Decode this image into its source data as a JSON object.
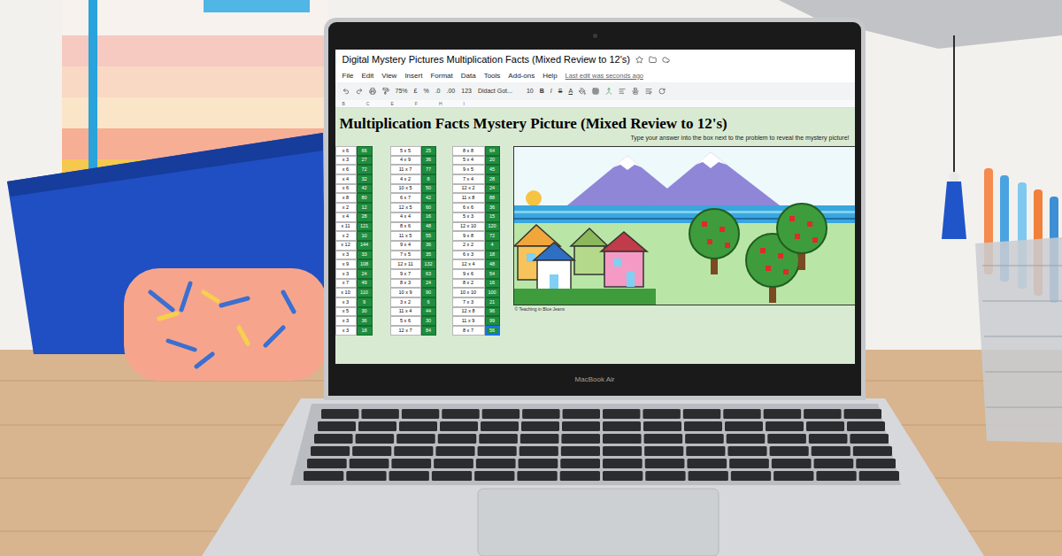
{
  "window": {
    "title": "Digital Mystery Pictures Multiplication Facts (Mixed Review to 12's)",
    "status": "Last edit was seconds ago"
  },
  "menu": [
    "File",
    "Edit",
    "View",
    "Insert",
    "Format",
    "Data",
    "Tools",
    "Add-ons",
    "Help"
  ],
  "toolbar": [
    "75%",
    "£",
    "%",
    ".0",
    ".00",
    "123",
    "Didact Got...",
    "10",
    "B",
    "I",
    "S",
    "A"
  ],
  "column_headers": [
    "B",
    "C",
    "E",
    "F",
    "H",
    "I"
  ],
  "sheet": {
    "heading": "Multiplication Facts Mystery Picture (Mixed Review to 12's)",
    "instruction": "Type your answer into the box next to the problem to reveal the mystery picture!",
    "columns": [
      {
        "cells": [
          {
            "problem": "x 6",
            "answer": "66",
            "selected": false
          },
          {
            "problem": "x 3",
            "answer": "27",
            "selected": false
          },
          {
            "problem": "x 6",
            "answer": "72",
            "selected": false
          },
          {
            "problem": "x 4",
            "answer": "32",
            "selected": false
          },
          {
            "problem": "x 6",
            "answer": "42",
            "selected": false
          },
          {
            "problem": "x 8",
            "answer": "80",
            "selected": false
          },
          {
            "problem": "x 2",
            "answer": "12",
            "selected": false
          },
          {
            "problem": "x 4",
            "answer": "28",
            "selected": false
          },
          {
            "problem": "x 11",
            "answer": "121",
            "selected": false
          },
          {
            "problem": "x 2",
            "answer": "10",
            "selected": false
          },
          {
            "problem": "x 12",
            "answer": "144",
            "selected": false
          },
          {
            "problem": "x 3",
            "answer": "33",
            "selected": false
          },
          {
            "problem": "x 9",
            "answer": "108",
            "selected": false
          },
          {
            "problem": "x 3",
            "answer": "24",
            "selected": false
          },
          {
            "problem": "x 7",
            "answer": "49",
            "selected": false
          },
          {
            "problem": "x 10",
            "answer": "110",
            "selected": false
          },
          {
            "problem": "x 3",
            "answer": "9",
            "selected": false
          },
          {
            "problem": "x 5",
            "answer": "30",
            "selected": false
          },
          {
            "problem": "x 3",
            "answer": "36",
            "selected": false
          },
          {
            "problem": "x 3",
            "answer": "18",
            "selected": false
          }
        ]
      },
      {
        "cells": [
          {
            "problem": "5 x 5",
            "answer": "25",
            "selected": false
          },
          {
            "problem": "4 x 9",
            "answer": "36",
            "selected": false
          },
          {
            "problem": "11 x 7",
            "answer": "77",
            "selected": false
          },
          {
            "problem": "4 x 2",
            "answer": "8",
            "selected": false
          },
          {
            "problem": "10 x 5",
            "answer": "50",
            "selected": false
          },
          {
            "problem": "6 x 7",
            "answer": "42",
            "selected": false
          },
          {
            "problem": "12 x 5",
            "answer": "60",
            "selected": false
          },
          {
            "problem": "4 x 4",
            "answer": "16",
            "selected": false
          },
          {
            "problem": "8 x 6",
            "answer": "48",
            "selected": false
          },
          {
            "problem": "11 x 5",
            "answer": "55",
            "selected": false
          },
          {
            "problem": "9 x 4",
            "answer": "36",
            "selected": false
          },
          {
            "problem": "7 x 5",
            "answer": "35",
            "selected": false
          },
          {
            "problem": "12 x 11",
            "answer": "132",
            "selected": false
          },
          {
            "problem": "9 x 7",
            "answer": "63",
            "selected": false
          },
          {
            "problem": "8 x 3",
            "answer": "24",
            "selected": false
          },
          {
            "problem": "10 x 9",
            "answer": "90",
            "selected": false
          },
          {
            "problem": "3 x 2",
            "answer": "6",
            "selected": false
          },
          {
            "problem": "11 x 4",
            "answer": "44",
            "selected": false
          },
          {
            "problem": "5 x 6",
            "answer": "30",
            "selected": false
          },
          {
            "problem": "12 x 7",
            "answer": "84",
            "selected": false
          }
        ]
      },
      {
        "cells": [
          {
            "problem": "8 x 8",
            "answer": "64",
            "selected": false
          },
          {
            "problem": "5 x 4",
            "answer": "20",
            "selected": false
          },
          {
            "problem": "9 x 5",
            "answer": "45",
            "selected": false
          },
          {
            "problem": "7 x 4",
            "answer": "28",
            "selected": false
          },
          {
            "problem": "12 x 2",
            "answer": "24",
            "selected": false
          },
          {
            "problem": "11 x 8",
            "answer": "88",
            "selected": false
          },
          {
            "problem": "6 x 6",
            "answer": "36",
            "selected": false
          },
          {
            "problem": "5 x 3",
            "answer": "15",
            "selected": false
          },
          {
            "problem": "12 x 10",
            "answer": "120",
            "selected": false
          },
          {
            "problem": "9 x 8",
            "answer": "72",
            "selected": false
          },
          {
            "problem": "2 x 2",
            "answer": "4",
            "selected": false
          },
          {
            "problem": "6 x 3",
            "answer": "18",
            "selected": false
          },
          {
            "problem": "12 x 4",
            "answer": "48",
            "selected": false
          },
          {
            "problem": "9 x 6",
            "answer": "54",
            "selected": false
          },
          {
            "problem": "8 x 2",
            "answer": "16",
            "selected": false
          },
          {
            "problem": "10 x 10",
            "answer": "100",
            "selected": false
          },
          {
            "problem": "7 x 3",
            "answer": "21",
            "selected": false
          },
          {
            "problem": "12 x 8",
            "answer": "96",
            "selected": false
          },
          {
            "problem": "11 x 9",
            "answer": "99",
            "selected": false
          },
          {
            "problem": "8 x 7",
            "answer": "56",
            "selected": true
          }
        ]
      }
    ],
    "credit": "© Teaching in Blue Jeans"
  },
  "device": {
    "label": "MacBook Air"
  }
}
